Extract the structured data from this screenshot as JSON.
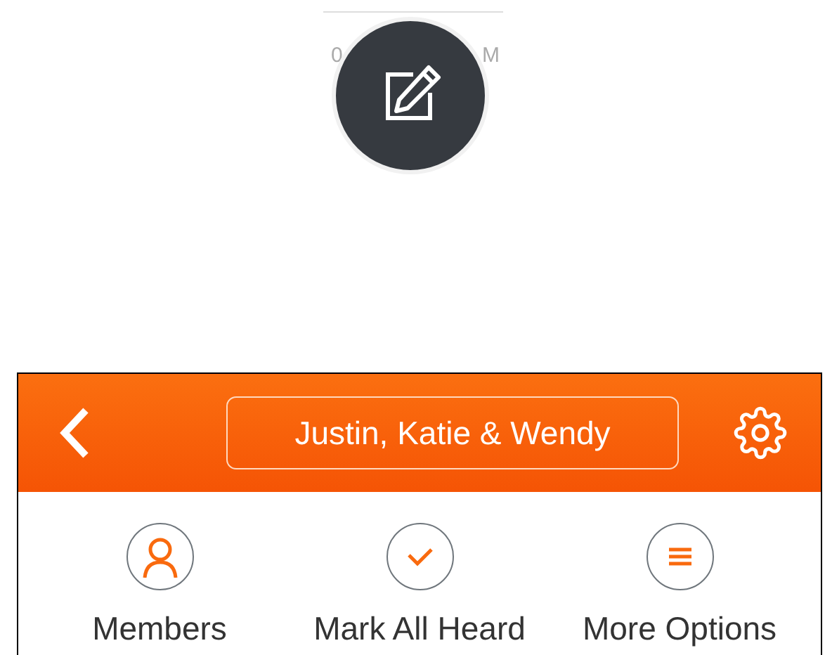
{
  "timestamp": {
    "left_fragment": "0",
    "right_fragment": "M"
  },
  "header": {
    "title": "Justin, Katie & Wendy"
  },
  "actions": [
    {
      "kind": "members",
      "label": "Members"
    },
    {
      "kind": "check",
      "label": "Mark All Heard"
    },
    {
      "kind": "menu",
      "label": "More Options"
    }
  ]
}
